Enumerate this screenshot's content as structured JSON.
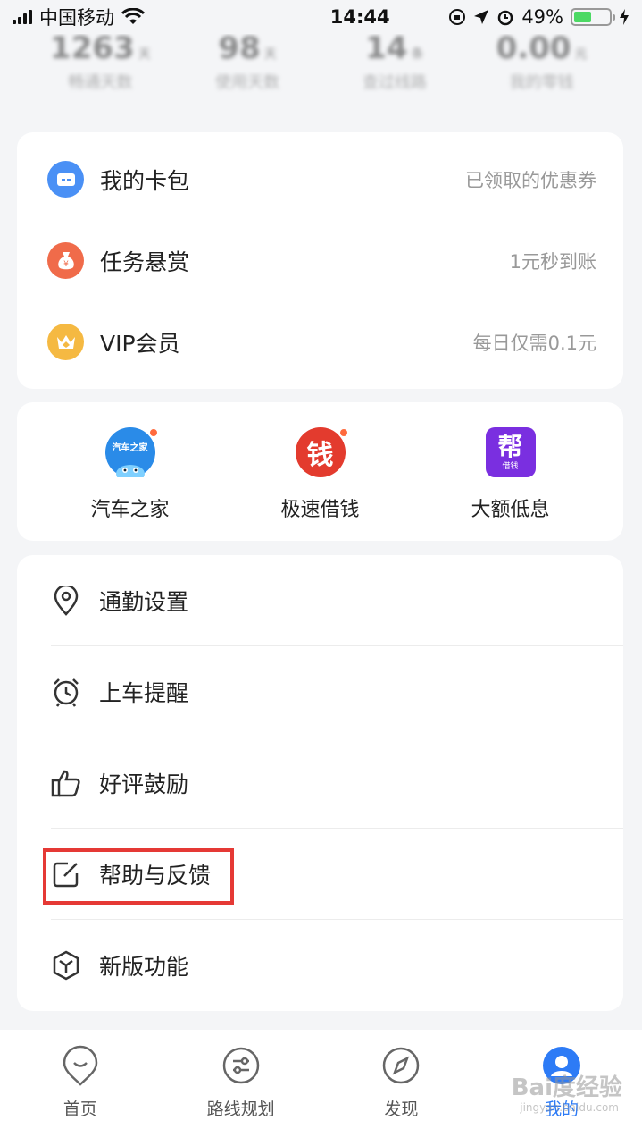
{
  "status_bar": {
    "carrier": "中国移动",
    "time": "14:44",
    "battery_percent": "49%",
    "battery_level": 0.49
  },
  "stats": [
    {
      "value": "1263",
      "unit": "天",
      "label": "畅通天数"
    },
    {
      "value": "98",
      "unit": "天",
      "label": "使用天数"
    },
    {
      "value": "14",
      "unit": "条",
      "label": "查过线路"
    },
    {
      "value": "0.00",
      "unit": "元",
      "label": "我的零钱"
    }
  ],
  "card_services": [
    {
      "label": "我的卡包",
      "subtitle": "已领取的优惠券",
      "icon": "card-wallet-icon",
      "color": "#4a90f5"
    },
    {
      "label": "任务悬赏",
      "subtitle": "1元秒到账",
      "icon": "money-bag-icon",
      "color": "#f06b4a"
    },
    {
      "label": "VIP会员",
      "subtitle": "每日仅需0.1元",
      "icon": "crown-icon",
      "color": "#f5b942"
    }
  ],
  "apps": [
    {
      "label": "汽车之家",
      "icon": "autohome-icon",
      "icon_text": "汽车之家",
      "color": "#2a8be8",
      "badge": true
    },
    {
      "label": "极速借钱",
      "icon": "loan-icon",
      "icon_text": "钱",
      "color": "#e33b2e",
      "badge": true
    },
    {
      "label": "大额低息",
      "icon": "bang-loan-icon",
      "icon_text": "帮",
      "icon_subtext": "借钱",
      "color": "#7a2fe0",
      "badge": false
    }
  ],
  "settings": [
    {
      "label": "通勤设置",
      "icon": "location-pin-icon"
    },
    {
      "label": "上车提醒",
      "icon": "alarm-clock-icon"
    },
    {
      "label": "好评鼓励",
      "icon": "thumbs-up-icon"
    },
    {
      "label": "帮助与反馈",
      "icon": "edit-feedback-icon"
    },
    {
      "label": "新版功能",
      "icon": "cube-icon"
    }
  ],
  "tabbar": [
    {
      "label": "首页",
      "icon": "home-smile-icon"
    },
    {
      "label": "路线规划",
      "icon": "route-icon"
    },
    {
      "label": "发现",
      "icon": "compass-icon"
    },
    {
      "label": "我的",
      "icon": "user-avatar-icon",
      "active": true
    }
  ],
  "watermark": {
    "text": "Bai度经验",
    "sub": "jingyan.baidu.com"
  },
  "colors": {
    "accent": "#2d7bf6",
    "highlight": "#e53935"
  }
}
